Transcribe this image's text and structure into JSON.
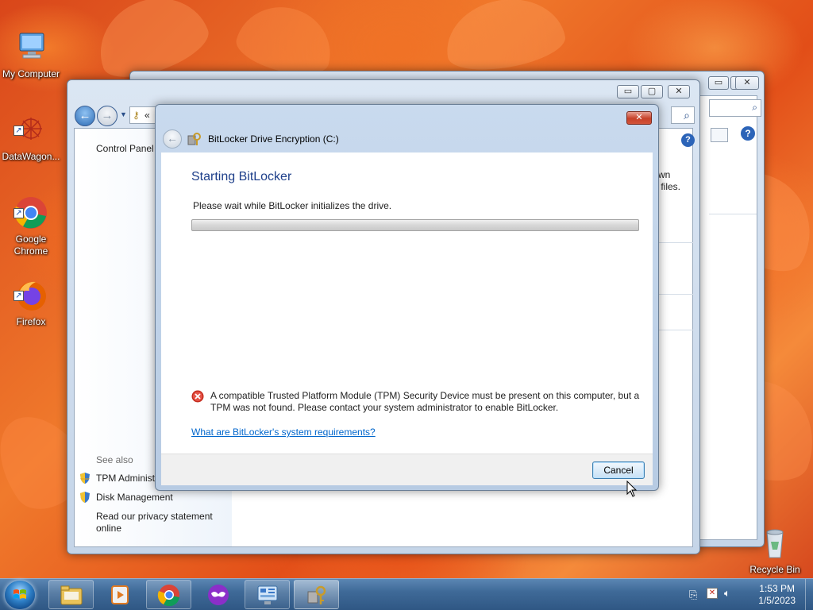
{
  "desktop": {
    "icons": [
      {
        "label": "My Computer"
      },
      {
        "label": "DataWagon..."
      },
      {
        "label": "Google\nChrome"
      },
      {
        "label": "Firefox"
      },
      {
        "label": "Recycle Bin"
      }
    ]
  },
  "back_window": {
    "controls": {
      "minimize": "▭",
      "restore": "▢",
      "close": "✕"
    }
  },
  "control_panel": {
    "address_fragment": "«",
    "search_icon": "search-icon",
    "left_title": "Control Panel",
    "right_fragments": [
      "wn",
      "r files."
    ],
    "see_also": {
      "heading": "See also",
      "items": [
        "TPM Administ",
        "Disk Management"
      ],
      "privacy": "Read our privacy statement\nonline"
    },
    "help_icon": "?"
  },
  "dialog": {
    "title": "BitLocker Drive Encryption (C:)",
    "heading": "Starting BitLocker",
    "wait_text": "Please wait while BitLocker initializes the drive.",
    "progress": 0,
    "error_text": "A compatible Trusted Platform Module (TPM) Security Device must be present on this computer, but a TPM was not found. Please contact your system administrator to enable BitLocker.",
    "link_text": "What are BitLocker's system requirements?",
    "cancel_label": "Cancel",
    "close_symbol": "✕"
  },
  "taskbar": {
    "clock_time": "1:53 PM",
    "clock_date": "1/5/2023"
  },
  "colors": {
    "link": "#0066cc",
    "heading": "#1e3f8a",
    "error": "#c42b1c"
  }
}
